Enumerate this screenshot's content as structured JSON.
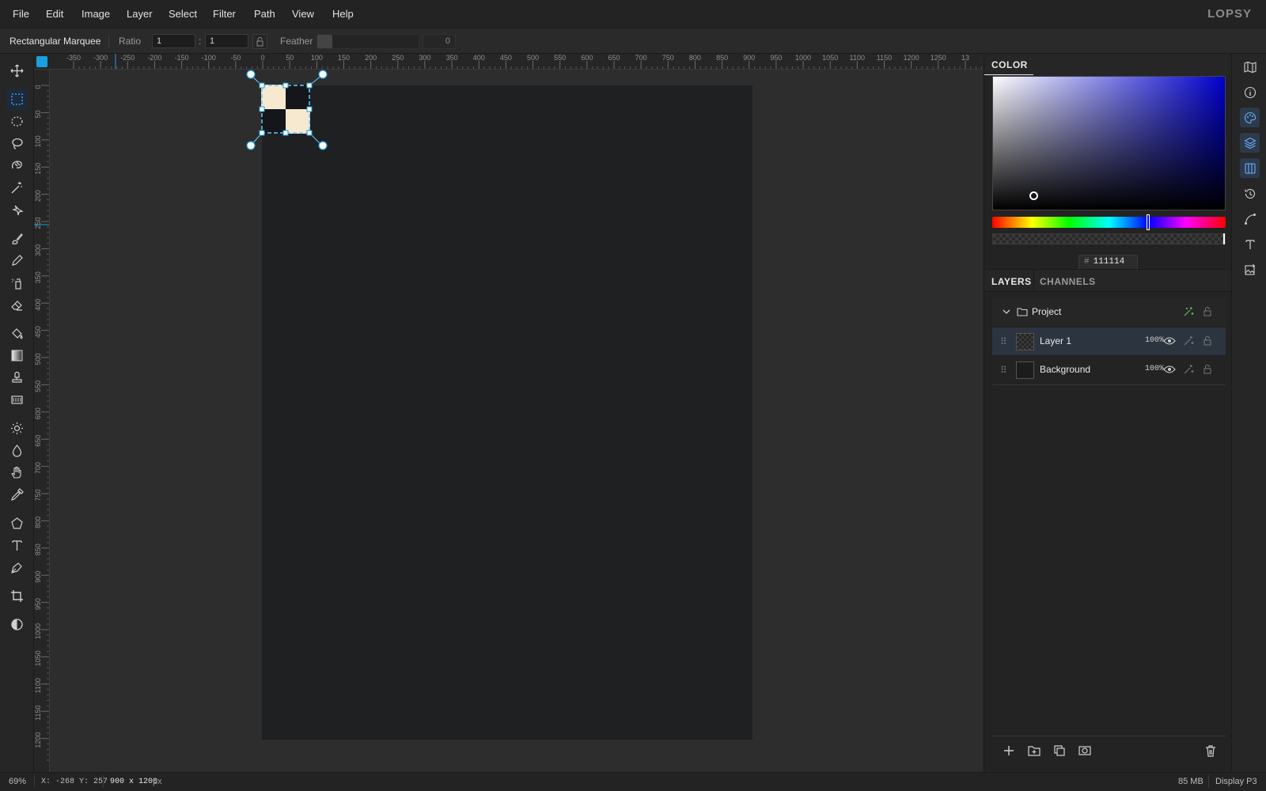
{
  "app": {
    "logo": "LOPSY"
  },
  "menu": [
    "File",
    "Edit",
    "Image",
    "Layer",
    "Select",
    "Filter",
    "Path",
    "View",
    "Help"
  ],
  "options": {
    "tool_name": "Rectangular Marquee",
    "ratio_label": "Ratio",
    "ratio_w": "1",
    "ratio_sep": ":",
    "ratio_h": "1",
    "feather_label": "Feather",
    "feather_value": "0"
  },
  "tools": [
    {
      "name": "move-tool",
      "icon": "move-icon"
    },
    {
      "name": "rect-marquee-tool",
      "icon": "rect-marquee-icon",
      "active": true
    },
    {
      "name": "ellipse-marquee-tool",
      "icon": "ellipse-marquee-icon"
    },
    {
      "name": "lasso-tool",
      "icon": "lasso-icon"
    },
    {
      "name": "magnetic-lasso-tool",
      "icon": "magnetic-lasso-icon"
    },
    {
      "name": "magic-wand-tool",
      "icon": "magic-wand-icon"
    },
    {
      "name": "quick-select-tool",
      "icon": "quick-select-icon"
    },
    {
      "name": "brush-tool",
      "icon": "brush-icon"
    },
    {
      "name": "pencil-tool",
      "icon": "pencil-icon"
    },
    {
      "name": "spray-tool",
      "icon": "spray-icon"
    },
    {
      "name": "eraser-tool",
      "icon": "eraser-icon"
    },
    {
      "name": "fill-tool",
      "icon": "paint-bucket-icon"
    },
    {
      "name": "gradient-tool",
      "icon": "gradient-icon"
    },
    {
      "name": "stamp-tool",
      "icon": "clone-stamp-icon"
    },
    {
      "name": "pattern-tool",
      "icon": "pattern-icon"
    },
    {
      "name": "dodge-tool",
      "icon": "sun-icon"
    },
    {
      "name": "blur-tool",
      "icon": "drop-icon"
    },
    {
      "name": "smudge-tool",
      "icon": "hand-icon"
    },
    {
      "name": "eyedropper-tool",
      "icon": "eyedropper-icon"
    },
    {
      "name": "shape-tool",
      "icon": "pentagon-icon"
    },
    {
      "name": "text-tool",
      "icon": "text-icon"
    },
    {
      "name": "pen-tool",
      "icon": "pen-icon"
    },
    {
      "name": "crop-tool",
      "icon": "crop-icon"
    },
    {
      "name": "mask-tool",
      "icon": "contrast-icon"
    }
  ],
  "ruler": {
    "top_labels": [
      "-350",
      "-300",
      "-250",
      "-200",
      "-150",
      "-100",
      "-50",
      "0",
      "50",
      "100",
      "150",
      "200",
      "250",
      "300",
      "350",
      "400",
      "450",
      "500",
      "550",
      "600",
      "650",
      "700",
      "750",
      "800",
      "850",
      "900",
      "950",
      "1000",
      "1050",
      "1100",
      "1150",
      "1200",
      "1250",
      "13"
    ],
    "left_labels": [
      "0",
      "50",
      "100",
      "150",
      "200",
      "250",
      "300",
      "350",
      "400",
      "450",
      "500",
      "550",
      "600",
      "650",
      "700",
      "750",
      "800",
      "850",
      "900",
      "950",
      "1000",
      "1050",
      "1100",
      "1150",
      "1200"
    ]
  },
  "color_panel": {
    "title": "COLOR",
    "hex_prefix": "#",
    "hex": "111114",
    "hue": 240,
    "alpha": 1
  },
  "layers_panel": {
    "tab_layers": "LAYERS",
    "tab_channels": "CHANNELS",
    "group_name": "Project",
    "layers": [
      {
        "name": "Layer 1",
        "opacity": "100%",
        "selected": true
      },
      {
        "name": "Background",
        "opacity": "100%",
        "selected": false
      }
    ]
  },
  "strip": [
    "map-icon",
    "info-icon",
    "palette-icon",
    "layers-icon",
    "channels-icon",
    "history-icon",
    "path-icon",
    "type-icon",
    "image-add-icon"
  ],
  "status": {
    "zoom": "69%",
    "coords": "X: -268 Y: 257",
    "doc_size": "900 x 1200",
    "doc_unit": "px",
    "memory": "85 MB",
    "color_profile": "Display P3"
  }
}
